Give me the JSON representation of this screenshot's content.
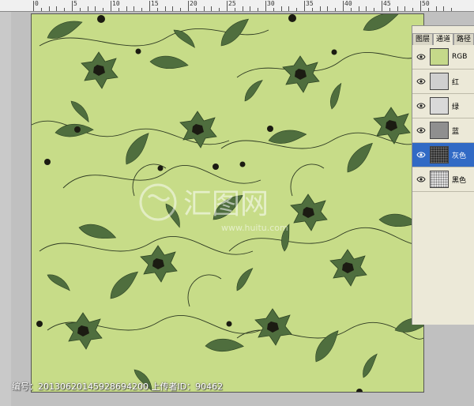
{
  "panel": {
    "tabs": [
      {
        "label": "图层"
      },
      {
        "label": "通道"
      },
      {
        "label": "路径"
      }
    ],
    "channels": [
      {
        "label": "RGB",
        "thumb_color": "#c5d98a"
      },
      {
        "label": "红",
        "thumb_color": "#cfcfcf"
      },
      {
        "label": "绿",
        "thumb_color": "#d9d9d9"
      },
      {
        "label": "蓝",
        "thumb_color": "#8f8f8f"
      },
      {
        "label": "灰色",
        "thumb_color": "#303030",
        "selected": true
      },
      {
        "label": "黑色",
        "thumb_color": "#e0e0e0"
      }
    ]
  },
  "ruler": {
    "labels": [
      "0",
      "5",
      "10",
      "15",
      "20",
      "25",
      "30",
      "35",
      "40",
      "45",
      "50"
    ]
  },
  "footer": {
    "watermark": "编号：20130620145928694200 上传者ID：90462"
  },
  "watermark_logo": {
    "brand": "汇图网",
    "url": "www.huitu.com"
  },
  "colors": {
    "background": "#c7dc88",
    "leaf": "#4f6e3e",
    "flower_center": "#1b1b12",
    "selection": "#316ac5"
  }
}
